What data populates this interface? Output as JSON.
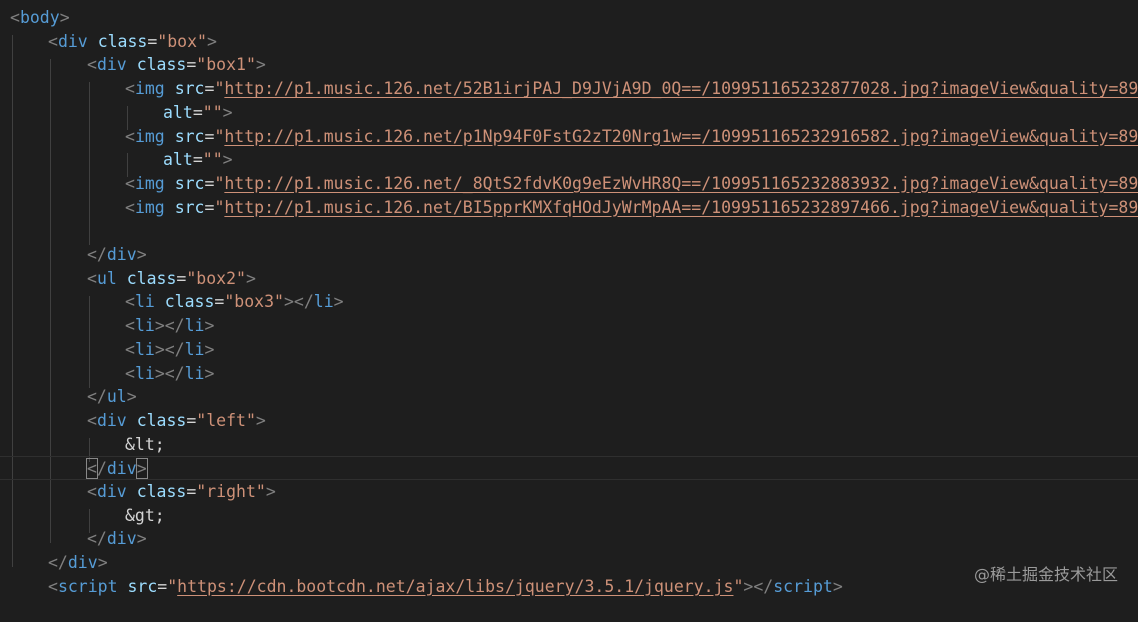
{
  "code": {
    "l01": {
      "tag": "body"
    },
    "l02": {
      "tag": "div",
      "attr": "class",
      "value": "box"
    },
    "l03": {
      "tag": "div",
      "attr": "class",
      "value": "box1"
    },
    "l04": {
      "tag": "img",
      "attr": "src",
      "url": "http://p1.music.126.net/52B1irjPAJ_D9JVjA9D_0Q==/109951165232877028.jpg?imageView&quality=89"
    },
    "l05": {
      "attr": "alt",
      "value": ""
    },
    "l06": {
      "tag": "img",
      "attr": "src",
      "url": "http://p1.music.126.net/p1Np94F0FstG2zT20Nrg1w==/109951165232916582.jpg?imageView&quality=89"
    },
    "l07": {
      "attr": "alt",
      "value": ""
    },
    "l08": {
      "tag": "img",
      "attr": "src",
      "url": "http://p1.music.126.net/_8QtS2fdvK0g9eEzWvHR8Q==/109951165232883932.jpg?imageView&quality=89"
    },
    "l09": {
      "tag": "img",
      "attr": "src",
      "url": "http://p1.music.126.net/BI5pprKMXfqHOdJyWrMpAA==/109951165232897466.jpg?imageView&quality=89"
    },
    "l11": {
      "tag": "div"
    },
    "l12": {
      "tag": "ul",
      "attr": "class",
      "value": "box2"
    },
    "l13": {
      "tag": "li",
      "attr": "class",
      "value": "box3"
    },
    "l14": {
      "tag": "li"
    },
    "l15": {
      "tag": "li"
    },
    "l16": {
      "tag": "li"
    },
    "l17": {
      "tag": "ul"
    },
    "l18": {
      "tag": "div",
      "attr": "class",
      "value": "left"
    },
    "l19": {
      "text": "&lt;"
    },
    "l20": {
      "tag": "div"
    },
    "l21": {
      "tag": "div",
      "attr": "class",
      "value": "right"
    },
    "l22": {
      "text": "&gt;"
    },
    "l23": {
      "tag": "div"
    },
    "l24": {
      "tag": "div"
    },
    "l25": {
      "tag": "script",
      "attr": "src",
      "url": "https://cdn.bootcdn.net/ajax/libs/jquery/3.5.1/jquery.js"
    }
  },
  "watermark": "@稀土掘金技术社区",
  "colors": {
    "background": "#1e1e1e",
    "bracket": "#808080",
    "tag": "#569cd6",
    "attribute": "#9cdcfe",
    "string": "#ce9178",
    "text": "#d4d4d4"
  }
}
